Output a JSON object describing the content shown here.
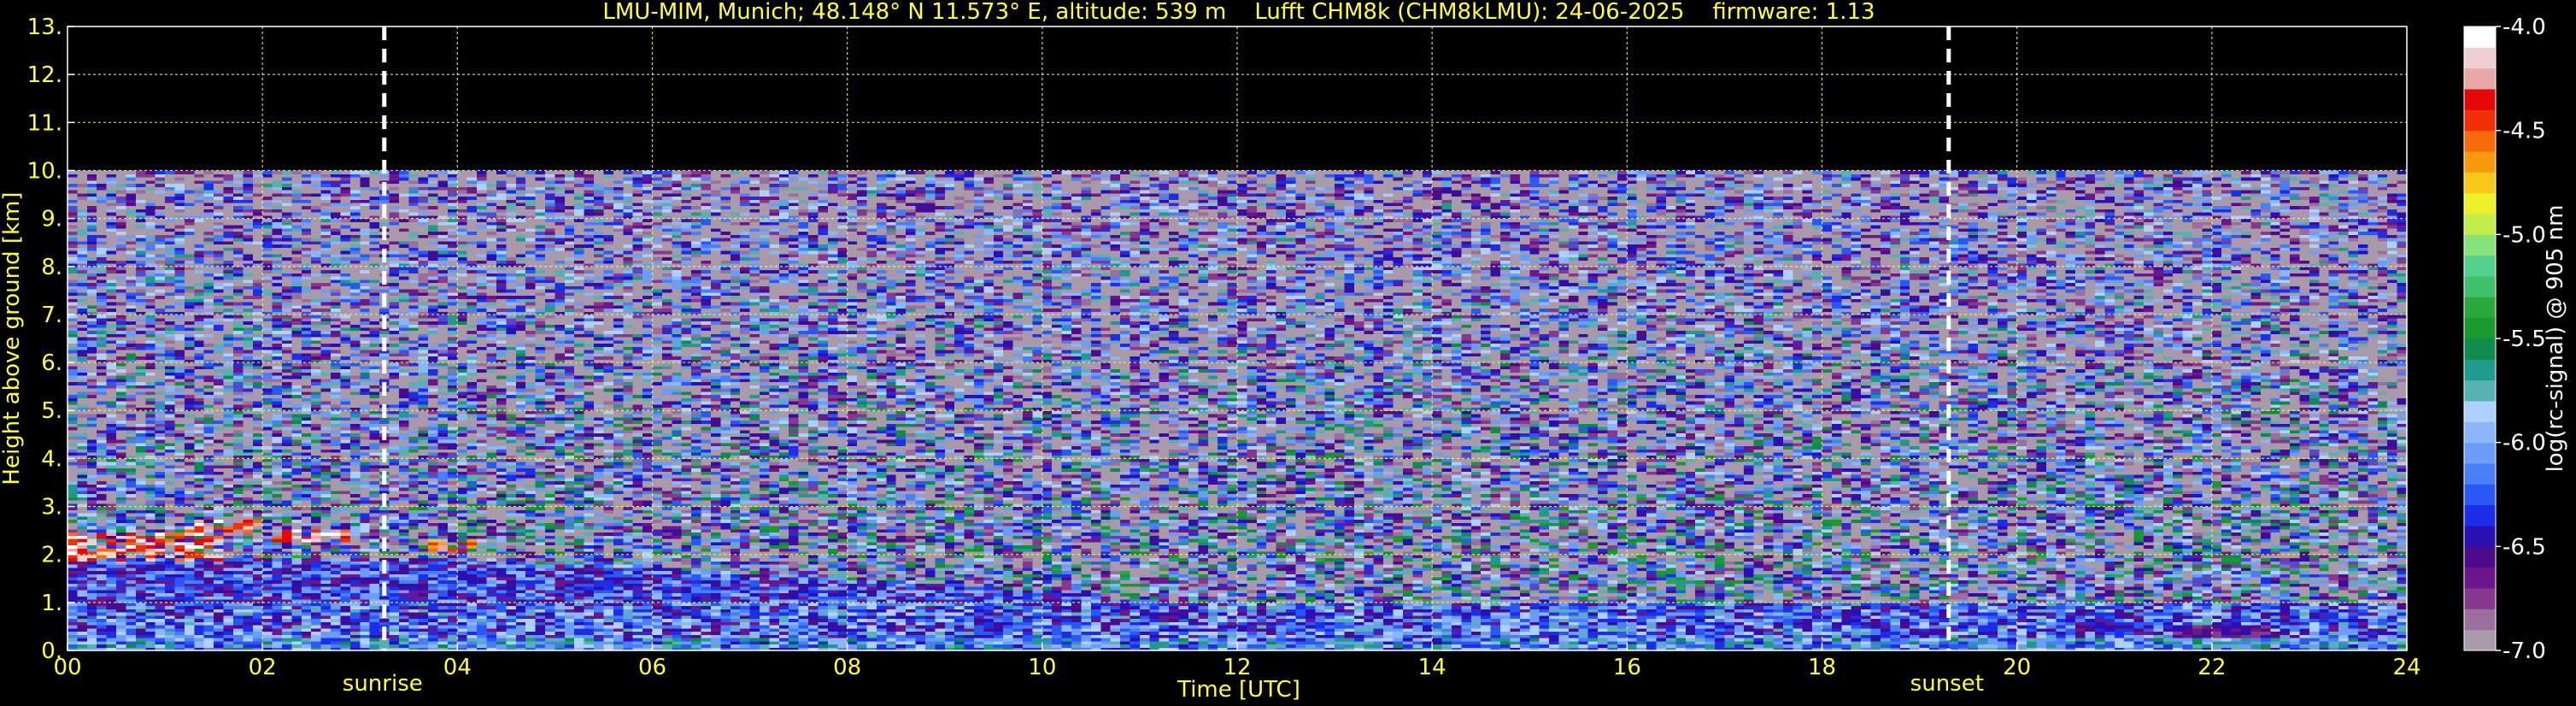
{
  "chart_data": {
    "type": "heatmap",
    "title": "LMU-MIM, Munich; 48.148° N 11.573° E, altitude: 539 m    Lufft CHM8k (CHM8kLMU): 24-06-2025    firmware: 1.13",
    "xlabel": "Time [UTC]",
    "ylabel": "Height above ground [km]",
    "colorbar_label": "log(rc-signal) @ 905 nm",
    "xlim": [
      0,
      24
    ],
    "ylim": [
      0,
      13
    ],
    "x_ticks": [
      0,
      2,
      4,
      6,
      8,
      10,
      12,
      14,
      16,
      18,
      20,
      22,
      24
    ],
    "x_tick_labels": [
      "00",
      "02",
      "04",
      "06",
      "08",
      "10",
      "12",
      "14",
      "16",
      "18",
      "20",
      "22",
      "24"
    ],
    "y_ticks": [
      0,
      1,
      2,
      3,
      4,
      5,
      6,
      7,
      8,
      9,
      10,
      11,
      12,
      13
    ],
    "y_tick_labels": [
      "0.",
      "1.",
      "2.",
      "3.",
      "4.",
      "5.",
      "6.",
      "7.",
      "8.",
      "9.",
      "10.",
      "11.",
      "12.",
      "13."
    ],
    "grid": true,
    "colorbar": {
      "range": [
        -7.0,
        -4.0
      ],
      "ticks": [
        -7.0,
        -6.5,
        -6.0,
        -5.5,
        -5.0,
        -4.5,
        -4.0
      ],
      "tick_labels": [
        "-7.0",
        "-6.5",
        "-6.0",
        "-5.5",
        "-5.0",
        "-4.5",
        "-4.0"
      ],
      "colors": [
        "#a89aa8",
        "#9a6f9e",
        "#86388e",
        "#6d168a",
        "#4c0a8c",
        "#2a10b4",
        "#1c2ee8",
        "#2a58f4",
        "#4a7ef6",
        "#6a9cf8",
        "#8cb6fa",
        "#aed0fc",
        "#57b1b0",
        "#1f9b8d",
        "#118a4d",
        "#1a9a2d",
        "#2aa83c",
        "#3fc06a",
        "#54d08c",
        "#88e27a",
        "#c2ee4c",
        "#eef02a",
        "#f8c818",
        "#f89a10",
        "#f86a0a",
        "#f23008",
        "#e40808",
        "#e8a8a8",
        "#f0d0d0",
        "#ffffff"
      ]
    },
    "events": [
      {
        "time": 3.25,
        "label": "sunrise"
      },
      {
        "time": 19.3,
        "label": "sunset"
      }
    ],
    "data_top_km": 10,
    "features": {
      "boundary_layer": {
        "height_km": [
          0.9,
          0.95,
          1.0,
          1.0,
          1.0,
          1.0,
          1.0,
          1.0,
          1.0,
          1.0,
          1.0,
          1.0,
          1.0
        ],
        "times": [
          0,
          2,
          4,
          6,
          8,
          10,
          12,
          14,
          16,
          18,
          20,
          22,
          24
        ],
        "level": -6.2
      },
      "residual_layer": {
        "height_km": [
          2.0,
          1.95,
          1.9,
          1.7,
          1.5,
          1.25,
          1.05,
          1.0
        ],
        "times": [
          0,
          2,
          4,
          6,
          8,
          10,
          11,
          12
        ],
        "level": -6.3
      },
      "cloud_layers": [
        {
          "t_start": 0.0,
          "t_end": 1.6,
          "base_km": 1.9,
          "top_km": 2.45,
          "level": -4.3
        },
        {
          "t_start": 1.2,
          "t_end": 2.0,
          "base_km": 2.45,
          "top_km": 2.7,
          "level": -4.3
        },
        {
          "t_start": 2.1,
          "t_end": 2.9,
          "base_km": 2.3,
          "top_km": 2.55,
          "level": -4.3
        },
        {
          "t_start": 3.7,
          "t_end": 4.2,
          "base_km": 2.1,
          "top_km": 2.3,
          "level": -4.5
        }
      ],
      "aerosol_events": [
        {
          "t_start": 20.6,
          "t_end": 21.2,
          "base_km": 0.4,
          "top_km": 0.6,
          "level": -6.5
        },
        {
          "t_start": 21.6,
          "t_end": 22.6,
          "base_km": 0.3,
          "top_km": 0.5,
          "level": -6.6
        }
      ]
    }
  }
}
